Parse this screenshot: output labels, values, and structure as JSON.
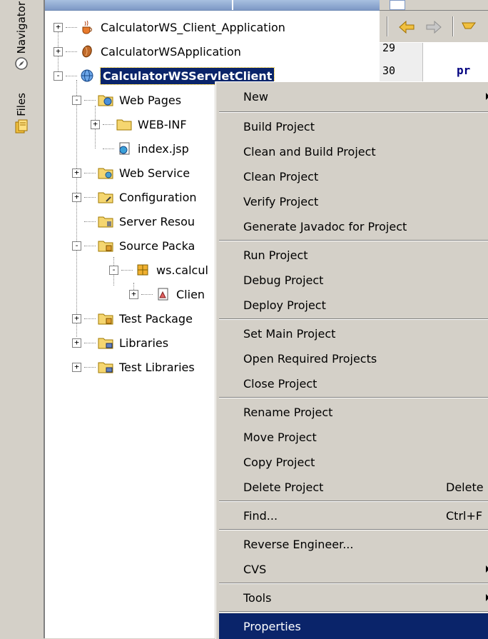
{
  "side_tabs": [
    {
      "label": "Navigator",
      "icon": "navigator-icon"
    },
    {
      "label": "Files",
      "icon": "files-icon"
    }
  ],
  "tree": {
    "nodes": [
      {
        "label": "CalculatorWS_Client_Application",
        "icon": "java-cup-icon",
        "expander": "+"
      },
      {
        "label": "CalculatorWSApplication",
        "icon": "bean-icon",
        "expander": "+"
      },
      {
        "label": "CalculatorWSServletClient",
        "icon": "globe-icon",
        "expander": "-",
        "selected": true
      },
      {
        "label": "Web Pages",
        "icon": "web-folder-icon",
        "expander": "-"
      },
      {
        "label": "WEB-INF",
        "icon": "folder-icon",
        "expander": "+"
      },
      {
        "label": "index.jsp",
        "icon": "jsp-file-icon",
        "expander": ""
      },
      {
        "label": "Web Service",
        "icon": "web-service-folder-icon",
        "expander": "+"
      },
      {
        "label": "Configuration",
        "icon": "config-folder-icon",
        "expander": "+"
      },
      {
        "label": "Server Resou",
        "icon": "server-folder-icon",
        "expander": ""
      },
      {
        "label": "Source Packa",
        "icon": "source-folder-icon",
        "expander": "-"
      },
      {
        "label": "ws.calcul",
        "icon": "package-icon",
        "expander": "-"
      },
      {
        "label": "Clien",
        "icon": "java-class-icon",
        "expander": "+"
      },
      {
        "label": "Test Package",
        "icon": "test-folder-icon",
        "expander": "+"
      },
      {
        "label": "Libraries",
        "icon": "library-folder-icon",
        "expander": "+"
      },
      {
        "label": "Test Libraries",
        "icon": "library-folder-icon",
        "expander": "+"
      }
    ]
  },
  "editor": {
    "line_numbers": [
      "29",
      "30"
    ],
    "code_line": "pr"
  },
  "context_menu": {
    "items": [
      {
        "label": "New",
        "submenu": true
      },
      {
        "label": "Build Project"
      },
      {
        "label": "Clean and Build Project"
      },
      {
        "label": "Clean Project"
      },
      {
        "label": "Verify Project"
      },
      {
        "label": "Generate Javadoc for Project"
      },
      {
        "label": "Run Project"
      },
      {
        "label": "Debug Project"
      },
      {
        "label": "Deploy Project"
      },
      {
        "label": "Set Main Project"
      },
      {
        "label": "Open Required Projects"
      },
      {
        "label": "Close Project"
      },
      {
        "label": "Rename Project"
      },
      {
        "label": "Move Project"
      },
      {
        "label": "Copy Project"
      },
      {
        "label": "Delete Project",
        "shortcut": "Delete"
      },
      {
        "label": "Find...",
        "shortcut": "Ctrl+F"
      },
      {
        "label": "Reverse Engineer..."
      },
      {
        "label": "CVS",
        "submenu": true
      },
      {
        "label": "Tools",
        "submenu": true
      },
      {
        "label": "Properties",
        "highlighted": true
      }
    ]
  },
  "colors": {
    "selection": "#0a246a",
    "menu_background": "#d4d0c8",
    "tree_background": "#ffffff"
  }
}
